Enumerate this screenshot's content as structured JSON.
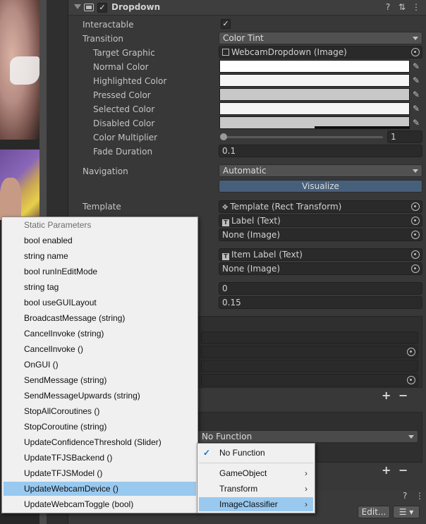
{
  "component": {
    "title": "Dropdown"
  },
  "rows": {
    "interactable_label": "Interactable",
    "transition_label": "Transition",
    "transition_value": "Color Tint",
    "target_graphic_label": "Target Graphic",
    "target_graphic_value": "WebcamDropdown (Image)",
    "normal_color_label": "Normal Color",
    "highlighted_color_label": "Highlighted Color",
    "pressed_color_label": "Pressed Color",
    "selected_color_label": "Selected Color",
    "disabled_color_label": "Disabled Color",
    "color_multiplier_label": "Color Multiplier",
    "color_multiplier_value": "1",
    "fade_duration_label": "Fade Duration",
    "fade_duration_value": "0.1",
    "navigation_label": "Navigation",
    "navigation_value": "Automatic",
    "visualize_label": "Visualize",
    "template_label": "Template",
    "template_value": "Template (Rect Transform)",
    "caption_text_value": "Label (Text)",
    "caption_image_value": "None (Image)",
    "item_text_value": "Item Label (Text)",
    "item_image_value": "None (Image)",
    "value_value": "0",
    "alpha_fade_value": "0.15",
    "no_function_value": "No Function",
    "plus_label": "+",
    "minus_label": "−",
    "edit_label": "Edit..."
  },
  "colors": {
    "normal": "#ffffff",
    "highlighted": "#f5f5f5",
    "pressed": "#c8c8c8",
    "selected": "#f5f5f5",
    "disabled": "#c8c8c8"
  },
  "color_multiplier_level": 0.0,
  "left_menu": {
    "header": "Static Parameters",
    "items": [
      "bool enabled",
      "string name",
      "bool runInEditMode",
      "string tag",
      "bool useGUILayout",
      "BroadcastMessage (string)",
      "CancelInvoke (string)",
      "CancelInvoke ()",
      "OnGUI ()",
      "SendMessage (string)",
      "SendMessageUpwards (string)",
      "StopAllCoroutines ()",
      "StopCoroutine (string)",
      "UpdateConfidenceThreshold (Slider)",
      "UpdateTFJSBackend ()",
      "UpdateTFJSModel ()",
      "UpdateWebcamDevice ()",
      "UpdateWebcamToggle (bool)"
    ],
    "selected_index": 16
  },
  "right_menu": {
    "items": [
      "No Function",
      "GameObject",
      "Transform",
      "ImageClassifier"
    ],
    "checked": "No Function",
    "selected": "ImageClassifier",
    "submenu_arrow": "›"
  }
}
